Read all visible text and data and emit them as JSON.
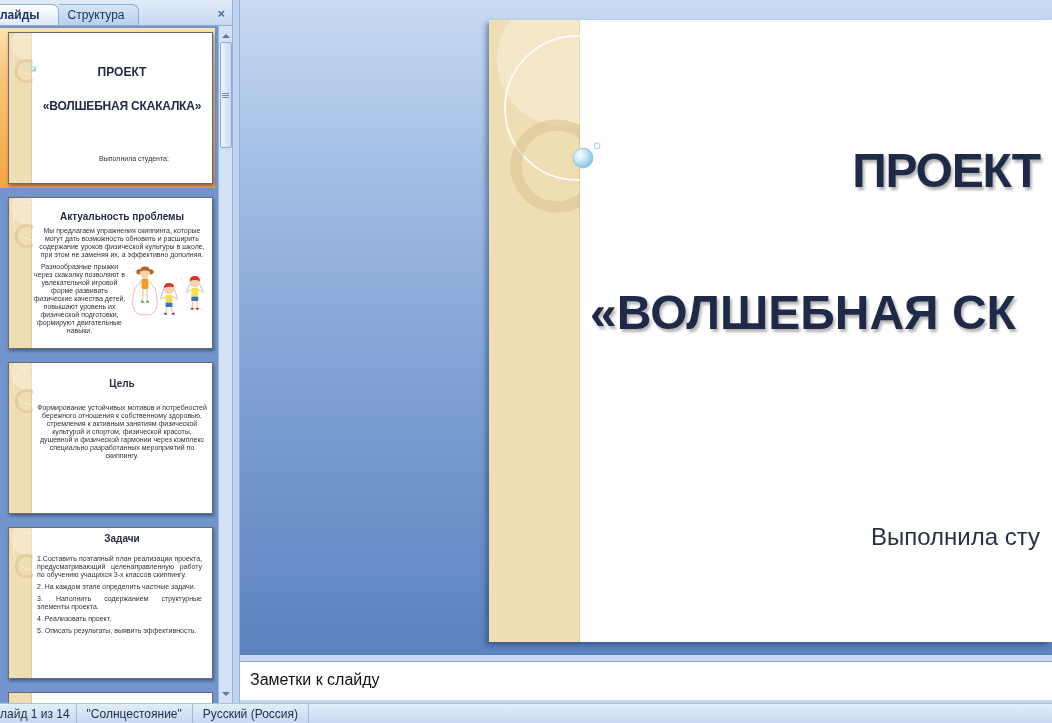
{
  "pane_tabs": [
    {
      "label": "лайды",
      "selected": true
    },
    {
      "label": "Структура",
      "selected": false
    }
  ],
  "pane_close": "×",
  "slides": [
    {
      "kind": "title",
      "selected": true,
      "title": "ПРОЕКТ",
      "subtitle": "«ВОЛШЕБНАЯ СКАКАЛКА»",
      "author": "Выполнила студента:"
    },
    {
      "kind": "text_picture",
      "selected": false,
      "title": "Актуальность проблемы",
      "paragraphs": [
        "Мы предлагаем упражнения скиппинга, которые могут дать возможность обновить и расширить содержание уроков физической культуры в школе, при этом не заменяя их, а эффективно дополняя.",
        "Разнообразные прыжки через скакалку позволяют в увлекательной игровой форме развивать физические качества детей, повышают уровень их физической подготовки, формируют двигательные навыки."
      ]
    },
    {
      "kind": "text",
      "selected": false,
      "title": "Цель",
      "paragraphs": [
        "Формирование устойчивых мотивов и потребностей бережного отношения к собственному здоровью, стремления к активным занятиям физической культурой и спортом, физической красоты, душевной и физической гармонии через комплекс специально разработанных мероприятий по скиппингу."
      ]
    },
    {
      "kind": "list",
      "selected": false,
      "title": "Задачи",
      "items": [
        "1.Составить поэтапный план реализации проекта, предусматривающий целенаправленную работу по обучению учащихся 3-х классов скиппингу.",
        "2. На каждом этапе определить частные задачи.",
        "3. Наполнить содержанием структурные элементы проекта.",
        "4. Реализовать проект.",
        "5. Описать результаты, выявить эффективность."
      ]
    },
    {
      "kind": "partial",
      "selected": false
    }
  ],
  "current_slide": {
    "title": "ПРОЕКТ",
    "subtitle": "«ВОЛШЕБНАЯ СК",
    "author": "Выполнила сту"
  },
  "notes": {
    "placeholder": "Заметки к слайду"
  },
  "status_bar": [
    "лайд 1 из 14",
    "\"Солнцестояние\"",
    "Русский (Россия)"
  ]
}
